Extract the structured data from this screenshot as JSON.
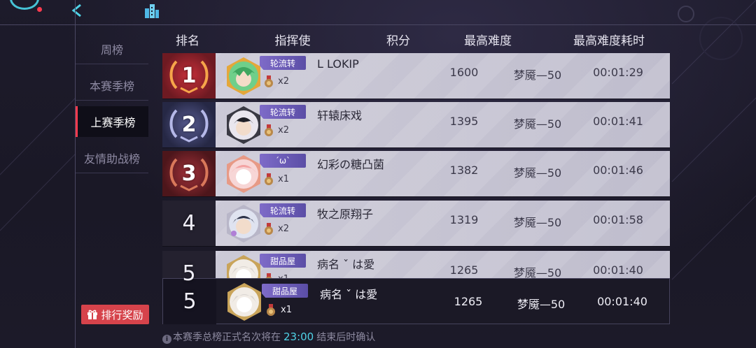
{
  "sidebar": {
    "items": [
      {
        "label": "周榜"
      },
      {
        "label": "本赛季榜"
      },
      {
        "label": "上赛季榜"
      },
      {
        "label": "友情助战榜"
      }
    ],
    "active_index": 2,
    "reward_label": "排行奖励"
  },
  "table": {
    "headers": {
      "rank": "排名",
      "commander": "指挥使",
      "points": "积分",
      "max_difficulty": "最高难度",
      "max_difficulty_time": "最高难度耗时"
    },
    "rows": [
      {
        "rank": "1",
        "tag": "轮流转",
        "name": "L LOKIP",
        "multiplier": "x2",
        "score": "1600",
        "difficulty": "梦魇—50",
        "time": "00:01:29"
      },
      {
        "rank": "2",
        "tag": "轮流转",
        "name": "轩辕床戏",
        "multiplier": "x2",
        "score": "1395",
        "difficulty": "梦魇—50",
        "time": "00:01:41"
      },
      {
        "rank": "3",
        "tag": "´ω`",
        "name": "幻彩の糖凸菌",
        "multiplier": "x1",
        "score": "1382",
        "difficulty": "梦魇—50",
        "time": "00:01:46"
      },
      {
        "rank": "4",
        "tag": "轮流转",
        "name": "牧之原翔子",
        "multiplier": "x2",
        "score": "1319",
        "difficulty": "梦魇—50",
        "time": "00:01:58"
      },
      {
        "rank": "5",
        "tag": "甜品屋",
        "name": "病名 ˇ は愛",
        "multiplier": "x1",
        "score": "1265",
        "difficulty": "梦魇—50",
        "time": "00:01:40"
      }
    ],
    "self": {
      "rank": "5",
      "tag": "甜品屋",
      "name": "病名 ˇ は愛",
      "multiplier": "x1",
      "score": "1265",
      "difficulty": "梦魇—50",
      "time": "00:01:40"
    }
  },
  "footnote": {
    "info_icon": "i",
    "prefix": "本赛季总榜正式名次将在",
    "time": "23:00",
    "suffix": "结束后时确认"
  },
  "colors": {
    "accent": "#ff3b4f",
    "highlight": "#4fd2e6",
    "tag": "#6d5db8",
    "reward": "#d6434b"
  }
}
